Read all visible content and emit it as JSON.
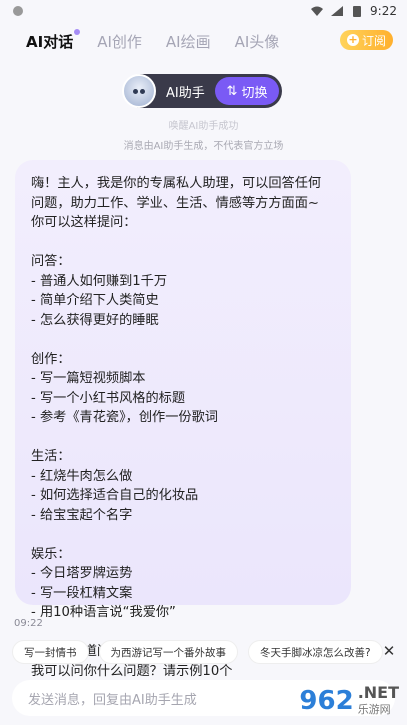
{
  "status_bar": {
    "time": "9:22"
  },
  "header": {
    "tabs": [
      {
        "label": "AI对话",
        "active": true
      },
      {
        "label": "AI创作",
        "active": false
      },
      {
        "label": "AI绘画",
        "active": false
      },
      {
        "label": "AI头像",
        "active": false
      }
    ],
    "subscribe_label": "订阅"
  },
  "assistant": {
    "name": "AI助手",
    "switch_label": "切换"
  },
  "notices": {
    "wake": "唤醒AI助手成功",
    "disclaimer": "消息由AI助手生成，不代表官方立场"
  },
  "message": {
    "lines": [
      "嗨！主人，我是你的专属私人助理，可以回答任何",
      "问题，助力工作、学业、生活、情感等方方面面~",
      "你可以这样提问：",
      "",
      "问答：",
      "- 普通人如何赚到1千万",
      "- 简单介绍下人类简史",
      "- 怎么获得更好的睡眠",
      "",
      "创作：",
      "- 写一篇短视频脚本",
      "- 写一个小红书风格的标题",
      "- 参考《青花瓷》，创作一份歌词",
      "",
      "生活：",
      "- 红烧牛肉怎么做",
      "- 如何选择适合自己的化妆品",
      "- 给宝宝起个名字",
      "",
      "娱乐：",
      "- 今日塔罗牌运势",
      "- 写一段杠精文案",
      "- 用10种语言说“我爱你”",
      "",
      "如果不知道问什么，可以直接问我：",
      "我可以问你什么问题？请示例10个"
    ],
    "time": "09:22"
  },
  "suggestions": [
    "写一封情书",
    "为西游记写一个番外故事",
    "冬天手脚冰凉怎么改善?"
  ],
  "input": {
    "placeholder": "发送消息，回复由AI助手生成"
  },
  "watermark": {
    "logo": "962",
    "net": ".NET",
    "sub": "乐游网"
  },
  "colors": {
    "accent": "#7a5af5",
    "subscribe": "#ffb02e",
    "bubble": "#eee9fc"
  }
}
